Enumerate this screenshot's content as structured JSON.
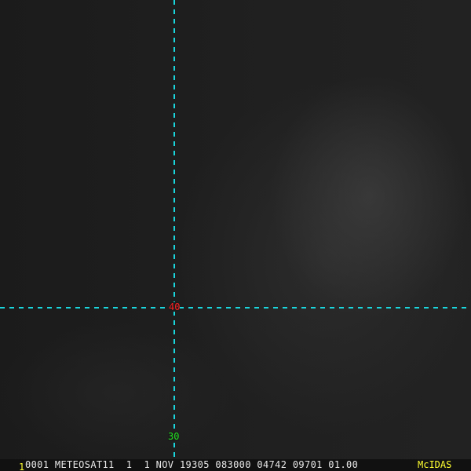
{
  "image": {
    "satellite_view": "infrared imagery"
  },
  "grid": {
    "line_color": "#1ad6dd",
    "latitude_label": "40",
    "latitude_label_color": "#ff2020",
    "longitude_label": "30",
    "longitude_label_color": "#20e020"
  },
  "status_bar": {
    "frame_number": "1",
    "info_text": "0001 METEOSAT11  1  1 NOV 19305 083000 04742 09701 01.00",
    "logo": "McIDAS"
  }
}
